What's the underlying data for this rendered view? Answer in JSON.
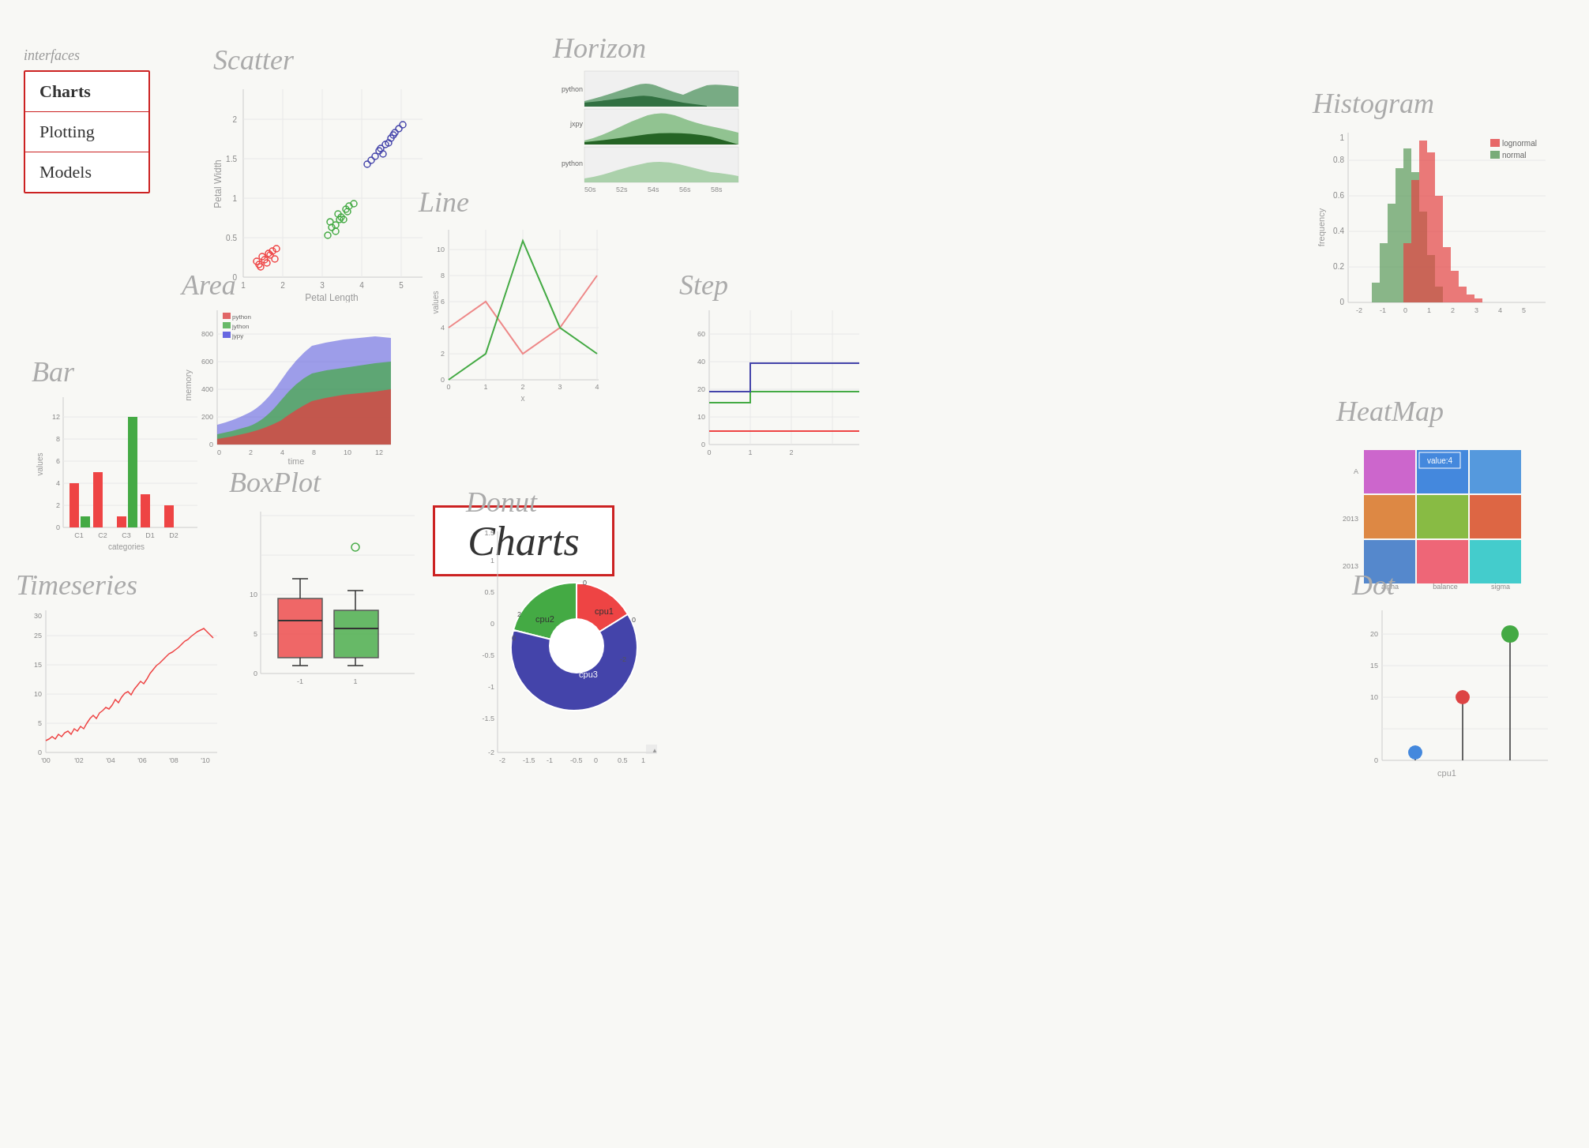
{
  "sidebar": {
    "interfaces_label": "interfaces",
    "items": [
      {
        "label": "Charts",
        "active": true
      },
      {
        "label": "Plotting",
        "active": false
      },
      {
        "label": "Models",
        "active": false
      }
    ]
  },
  "charts": {
    "scatter": {
      "title": "Scatter",
      "xlabel": "Petal Length",
      "ylabel": "Petal Width"
    },
    "horizon": {
      "title": "Horizon"
    },
    "histogram": {
      "title": "Histogram",
      "ylabel": "frequency",
      "legend": [
        {
          "label": "lognormal",
          "color": "#e88"
        },
        {
          "label": "normal",
          "color": "#8c8"
        }
      ]
    },
    "area": {
      "title": "Area",
      "xlabel": "time",
      "ylabel": "memory",
      "legend": [
        {
          "label": "python",
          "color": "#e44"
        },
        {
          "label": "jython",
          "color": "#4a4"
        },
        {
          "label": "jypy",
          "color": "#44e"
        }
      ]
    },
    "line": {
      "title": "Line",
      "xlabel": "x",
      "ylabel": "values"
    },
    "step": {
      "title": "Step"
    },
    "bar": {
      "title": "Bar",
      "xlabel": "categories",
      "ylabel": "values"
    },
    "charts_center": {
      "label": "Charts"
    },
    "boxplot": {
      "title": "BoxPlot"
    },
    "donut": {
      "title": "Donut",
      "segments": [
        "cpu1",
        "cpu2",
        "cpu3"
      ]
    },
    "heatmap": {
      "title": "HeatMap",
      "tooltip": "value:4"
    },
    "timeseries": {
      "title": "Timeseries"
    },
    "dot": {
      "title": "Dot",
      "xlabel": "cpu1"
    }
  }
}
